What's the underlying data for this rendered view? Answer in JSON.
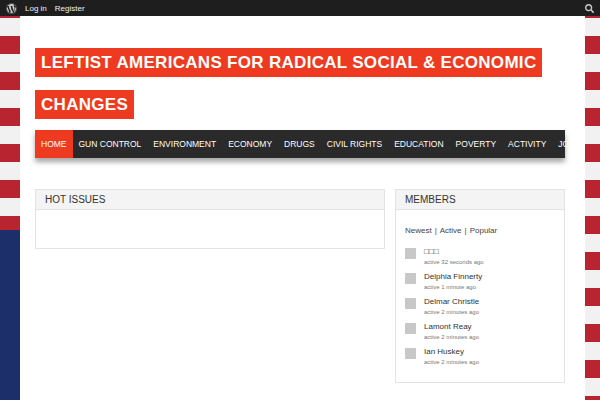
{
  "admin_bar": {
    "links": [
      "Log in",
      "Register"
    ]
  },
  "site": {
    "title": "LEFTIST AMERICANS FOR RADICAL SOCIAL & ECONOMIC CHANGES"
  },
  "nav": [
    {
      "label": "HOME",
      "selected": true
    },
    {
      "label": "GUN CONTROL",
      "selected": false
    },
    {
      "label": "ENVIRONMENT",
      "selected": false
    },
    {
      "label": "ECONOMY",
      "selected": false
    },
    {
      "label": "DRUGS",
      "selected": false
    },
    {
      "label": "CIVIL RIGHTS",
      "selected": false
    },
    {
      "label": "EDUCATION",
      "selected": false
    },
    {
      "label": "POVERTY",
      "selected": false
    },
    {
      "label": "ACTIVITY",
      "selected": false
    },
    {
      "label": "JOBS",
      "selected": false
    }
  ],
  "hot_issues": {
    "title": "HOT ISSUES"
  },
  "members": {
    "title": "MEMBERS",
    "filters": [
      "Newest",
      "Active",
      "Popular"
    ],
    "separator": "|",
    "items": [
      {
        "name": "□□□",
        "activity": "active 32 seconds ago"
      },
      {
        "name": "Delphia Finnerty",
        "activity": "active 1 minute ago"
      },
      {
        "name": "Delmar Christle",
        "activity": "active 2 minutes ago"
      },
      {
        "name": "Lamont Reay",
        "activity": "active 2 minutes ago"
      },
      {
        "name": "Ian Huskey",
        "activity": "active 2 minutes ago"
      }
    ]
  }
}
